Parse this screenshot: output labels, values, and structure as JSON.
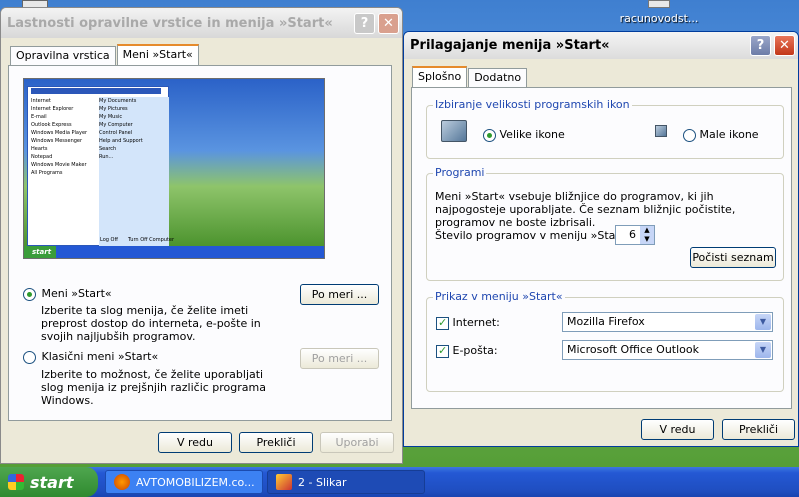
{
  "desktop": {
    "icon_label": "racunovodst..."
  },
  "win1": {
    "title": "Lastnosti opravilne vrstice in menija »Start«",
    "tabs": [
      "Opravilna vrstica",
      "Meni »Start«"
    ],
    "preview": {
      "start_label": "start",
      "left_items": [
        "Internet",
        "Internet Explorer",
        "E-mail",
        "Outlook Express",
        "Windows Media Player",
        "Windows Messenger",
        "Hearts",
        "Notepad",
        "Windows Movie Maker",
        "All Programs"
      ],
      "right_items": [
        "My Documents",
        "My Pictures",
        "My Music",
        "My Computer",
        "Control Panel",
        "Help and Support",
        "Search",
        "Run..."
      ],
      "logoff": "Log Off",
      "turnoff": "Turn Off Computer"
    },
    "option1": {
      "label": "Meni »Start«",
      "desc": "Izberite ta slog menija, če želite imeti preprost dostop do interneta, e-pošte in svojih najljubših programov.",
      "button": "Po meri ..."
    },
    "option2": {
      "label": "Klasični meni »Start«",
      "desc": "Izberite to možnost, če želite uporabljati slog menija iz prejšnjih različic programa Windows.",
      "button": "Po meri ..."
    },
    "buttons": {
      "ok": "V redu",
      "cancel": "Prekliči",
      "apply": "Uporabi"
    }
  },
  "win2": {
    "title": "Prilagajanje menija »Start«",
    "tabs": [
      "Splošno",
      "Dodatno"
    ],
    "icon_group": {
      "title": "Izbiranje velikosti programskih ikon",
      "large": "Velike ikone",
      "small": "Male ikone"
    },
    "programs_group": {
      "title": "Programi",
      "desc": "Meni »Start« vsebuje bližnjice do programov, ki jih najpogosteje uporabljate.  Če seznam bližnjic počistite, programov ne boste izbrisali.",
      "count_label": "Število programov v meniju »Start«:",
      "count_value": "6",
      "clear_button": "Počisti seznam"
    },
    "show_group": {
      "title": "Prikaz v meniju »Start«",
      "internet_label": "Internet:",
      "internet_value": "Mozilla Firefox",
      "email_label": "E-pošta:",
      "email_value": "Microsoft Office Outlook"
    },
    "buttons": {
      "ok": "V redu",
      "cancel": "Prekliči"
    }
  },
  "taskbar": {
    "start": "start",
    "tasks": [
      "AVTOMOBILIZEM.co...",
      "2 - Slikar"
    ]
  }
}
